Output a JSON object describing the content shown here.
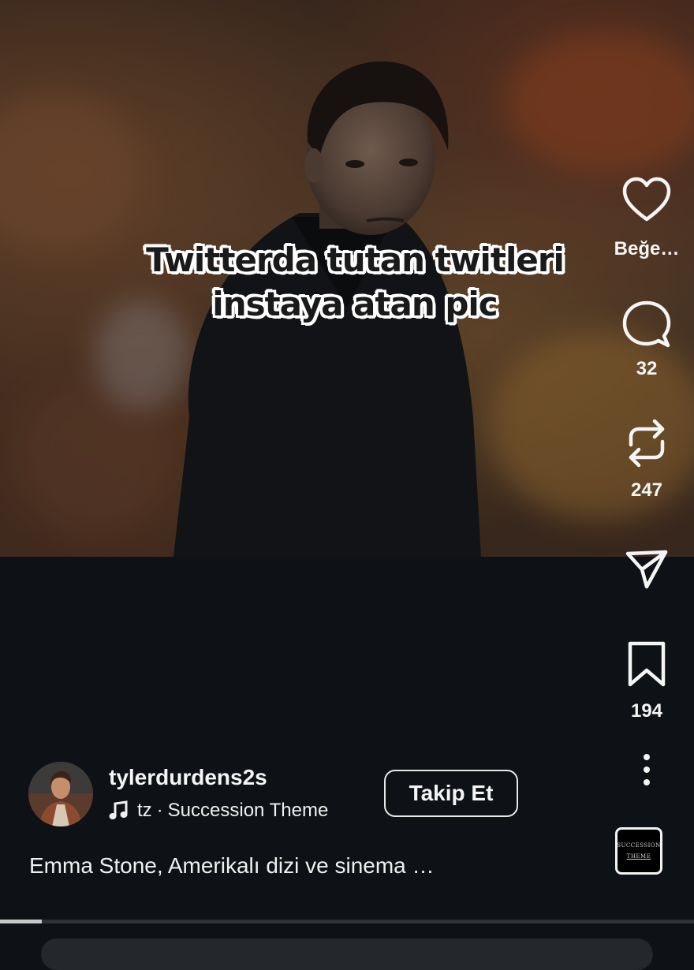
{
  "post": {
    "caption_line1": "Twitterda tutan twitleri",
    "caption_line2": "instaya atan pic",
    "progress": 0.06
  },
  "actions": {
    "like": {
      "icon": "heart-icon",
      "label": "Beğe…"
    },
    "comment": {
      "icon": "comment-icon",
      "count": "32"
    },
    "repost": {
      "icon": "repost-icon",
      "count": "247"
    },
    "share": {
      "icon": "send-icon"
    },
    "save": {
      "icon": "bookmark-icon",
      "count": "194"
    },
    "more": {
      "icon": "more-vertical-icon"
    }
  },
  "author": {
    "username": "tylerdurdens2s",
    "follow_label": "Takip Et",
    "music": {
      "icon": "music-note-icon",
      "artist": "tz",
      "separator": "·",
      "title": "Succession Theme"
    }
  },
  "description": "Emma Stone, Amerikalı dizi ve sinema …",
  "audio_thumb": {
    "line1": "SUCCESSION",
    "line2": "THEME"
  }
}
